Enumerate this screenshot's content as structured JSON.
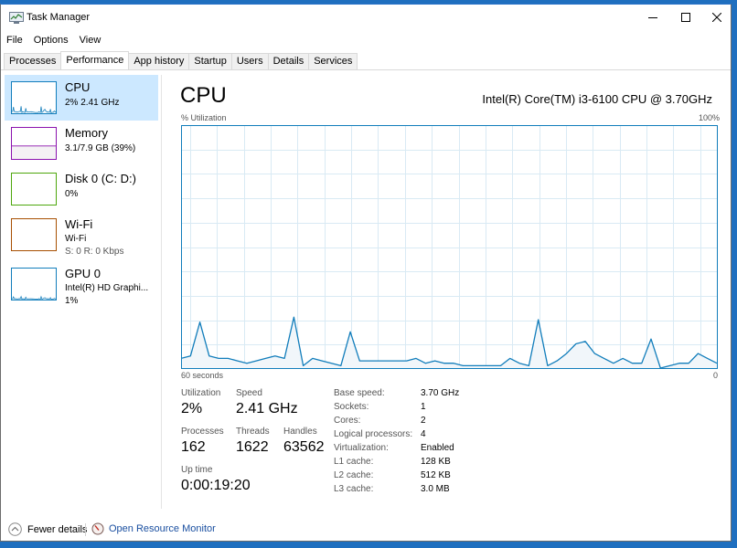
{
  "window": {
    "title": "Task Manager",
    "controls": {
      "minimize": "minimize",
      "maximize": "maximize",
      "close": "close"
    }
  },
  "menu": [
    "File",
    "Options",
    "View"
  ],
  "tabs": [
    {
      "label": "Processes",
      "active": false
    },
    {
      "label": "Performance",
      "active": true
    },
    {
      "label": "App history",
      "active": false
    },
    {
      "label": "Startup",
      "active": false
    },
    {
      "label": "Users",
      "active": false
    },
    {
      "label": "Details",
      "active": false
    },
    {
      "label": "Services",
      "active": false
    }
  ],
  "sidebar": {
    "items": [
      {
        "name": "CPU",
        "line1": "2% 2.41 GHz",
        "line2": "",
        "color": "#117dbb",
        "active": true
      },
      {
        "name": "Memory",
        "line1": "3.1/7.9 GB (39%)",
        "line2": "",
        "color": "#8b12ae",
        "active": false
      },
      {
        "name": "Disk 0 (C: D:)",
        "line1": "0%",
        "line2": "",
        "color": "#4da60c",
        "active": false
      },
      {
        "name": "Wi-Fi",
        "line1": "Wi-Fi",
        "line2": "S: 0 R: 0 Kbps",
        "color": "#a74f01",
        "active": false
      },
      {
        "name": "GPU 0",
        "line1": "Intel(R) HD Graphi...",
        "line2": "1%",
        "color": "#117dbb",
        "active": false
      }
    ]
  },
  "main": {
    "title": "CPU",
    "model": "Intel(R) Core(TM) i3-6100 CPU @ 3.70GHz",
    "y_label": "% Utilization",
    "y_max_label": "100%",
    "x_left_label": "60 seconds",
    "x_right_label": "0"
  },
  "chart_data": {
    "type": "area",
    "title": "CPU",
    "ylabel": "% Utilization",
    "xlabel": "60 seconds",
    "ylim": [
      0,
      100
    ],
    "xlim": [
      60,
      0
    ],
    "grid": true,
    "line_color": "#117dbb",
    "fill_color": "#f1f6fa",
    "grid_color": "#d9eaf4",
    "values": [
      4,
      5,
      19,
      5,
      4,
      4,
      3,
      2,
      3,
      4,
      5,
      4,
      21,
      1,
      4,
      3,
      2,
      1,
      15,
      3,
      3,
      3,
      3,
      3,
      3,
      4,
      2,
      3,
      2,
      2,
      1,
      1,
      1,
      1,
      1,
      4,
      2,
      1,
      20,
      1,
      3,
      6,
      10,
      11,
      6,
      4,
      2,
      4,
      2,
      2,
      12,
      0,
      1,
      2,
      2,
      6,
      4,
      2
    ]
  },
  "stats": {
    "utilization": {
      "label": "Utilization",
      "value": "2%"
    },
    "speed": {
      "label": "Speed",
      "value": "2.41 GHz"
    },
    "processes": {
      "label": "Processes",
      "value": "162"
    },
    "threads": {
      "label": "Threads",
      "value": "1622"
    },
    "handles": {
      "label": "Handles",
      "value": "63562"
    },
    "uptime": {
      "label": "Up time",
      "value": "0:00:19:20"
    }
  },
  "specs": [
    {
      "label": "Base speed:",
      "value": "3.70 GHz"
    },
    {
      "label": "Sockets:",
      "value": "1"
    },
    {
      "label": "Cores:",
      "value": "2"
    },
    {
      "label": "Logical processors:",
      "value": "4"
    },
    {
      "label": "Virtualization:",
      "value": "Enabled"
    },
    {
      "label": "L1 cache:",
      "value": "128 KB"
    },
    {
      "label": "L2 cache:",
      "value": "512 KB"
    },
    {
      "label": "L3 cache:",
      "value": "3.0 MB"
    }
  ],
  "footer": {
    "fewer_details": "Fewer details",
    "resource_monitor": "Open Resource Monitor"
  }
}
